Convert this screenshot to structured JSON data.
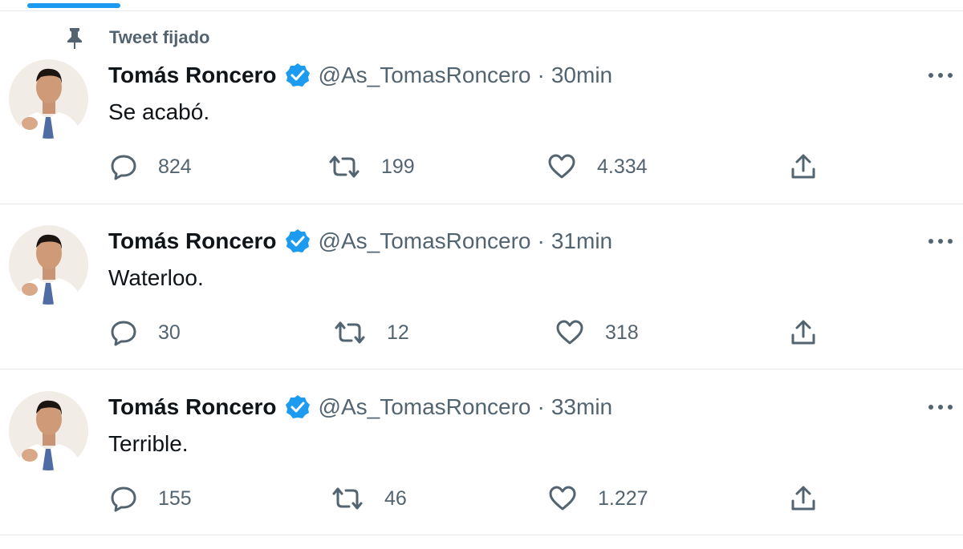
{
  "pinned_label": "Tweet fijado",
  "author": {
    "name": "Tomás Roncero",
    "handle": "@As_TomasRoncero",
    "verified": true
  },
  "separator": "·",
  "tweets": [
    {
      "time": "30min",
      "text": "Se acabó.",
      "replies": "824",
      "retweets": "199",
      "likes": "4.334",
      "pinned": true
    },
    {
      "time": "31min",
      "text": "Waterloo.",
      "replies": "30",
      "retweets": "12",
      "likes": "318",
      "pinned": false
    },
    {
      "time": "33min",
      "text": "Terrible.",
      "replies": "155",
      "retweets": "46",
      "likes": "1.227",
      "pinned": false
    }
  ],
  "icons": {
    "pin": "pin-icon",
    "verified": "verified-badge-icon",
    "more": "more-icon",
    "reply": "reply-icon",
    "retweet": "retweet-icon",
    "like": "like-icon",
    "share": "share-icon"
  },
  "colors": {
    "accent": "#1d9bf0",
    "secondary_text": "#536471",
    "primary_text": "#0f1419",
    "divider": "#e6e9eb"
  }
}
